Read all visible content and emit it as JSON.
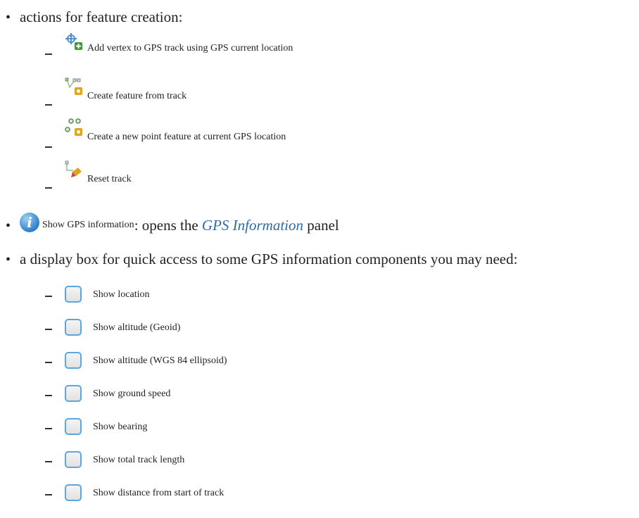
{
  "section_feature": {
    "bullet": "•",
    "text": "actions for feature creation:",
    "items": [
      {
        "icon": "add-vertex-icon",
        "label": "Add vertex to GPS track using GPS current location"
      },
      {
        "icon": "create-feature-from-track-icon",
        "label": "Create feature from track"
      },
      {
        "icon": "create-point-feature-icon",
        "label": "Create a new point feature at current GPS location"
      },
      {
        "icon": "reset-track-icon",
        "label": "Reset track"
      }
    ]
  },
  "section_info": {
    "bullet": "•",
    "icon_glyph": "i",
    "button_label": "Show GPS information",
    "text_before": ": opens the ",
    "link_text": "GPS Information",
    "text_after": " panel"
  },
  "section_display": {
    "bullet": "•",
    "text": "a display box for quick access to some GPS information components you may need:",
    "items": [
      {
        "label": "Show location"
      },
      {
        "label": "Show altitude (Geoid)"
      },
      {
        "label": "Show altitude (WGS 84 ellipsoid)"
      },
      {
        "label": "Show ground speed"
      },
      {
        "label": "Show bearing"
      },
      {
        "label": "Show total track length"
      },
      {
        "label": "Show distance from start of track"
      }
    ]
  },
  "colors": {
    "text": "#222222",
    "link": "#2d6aa8",
    "checkbox_border": "#5aa7e0",
    "icon_green": "#3a9a3a",
    "icon_yellow": "#e3a419"
  }
}
